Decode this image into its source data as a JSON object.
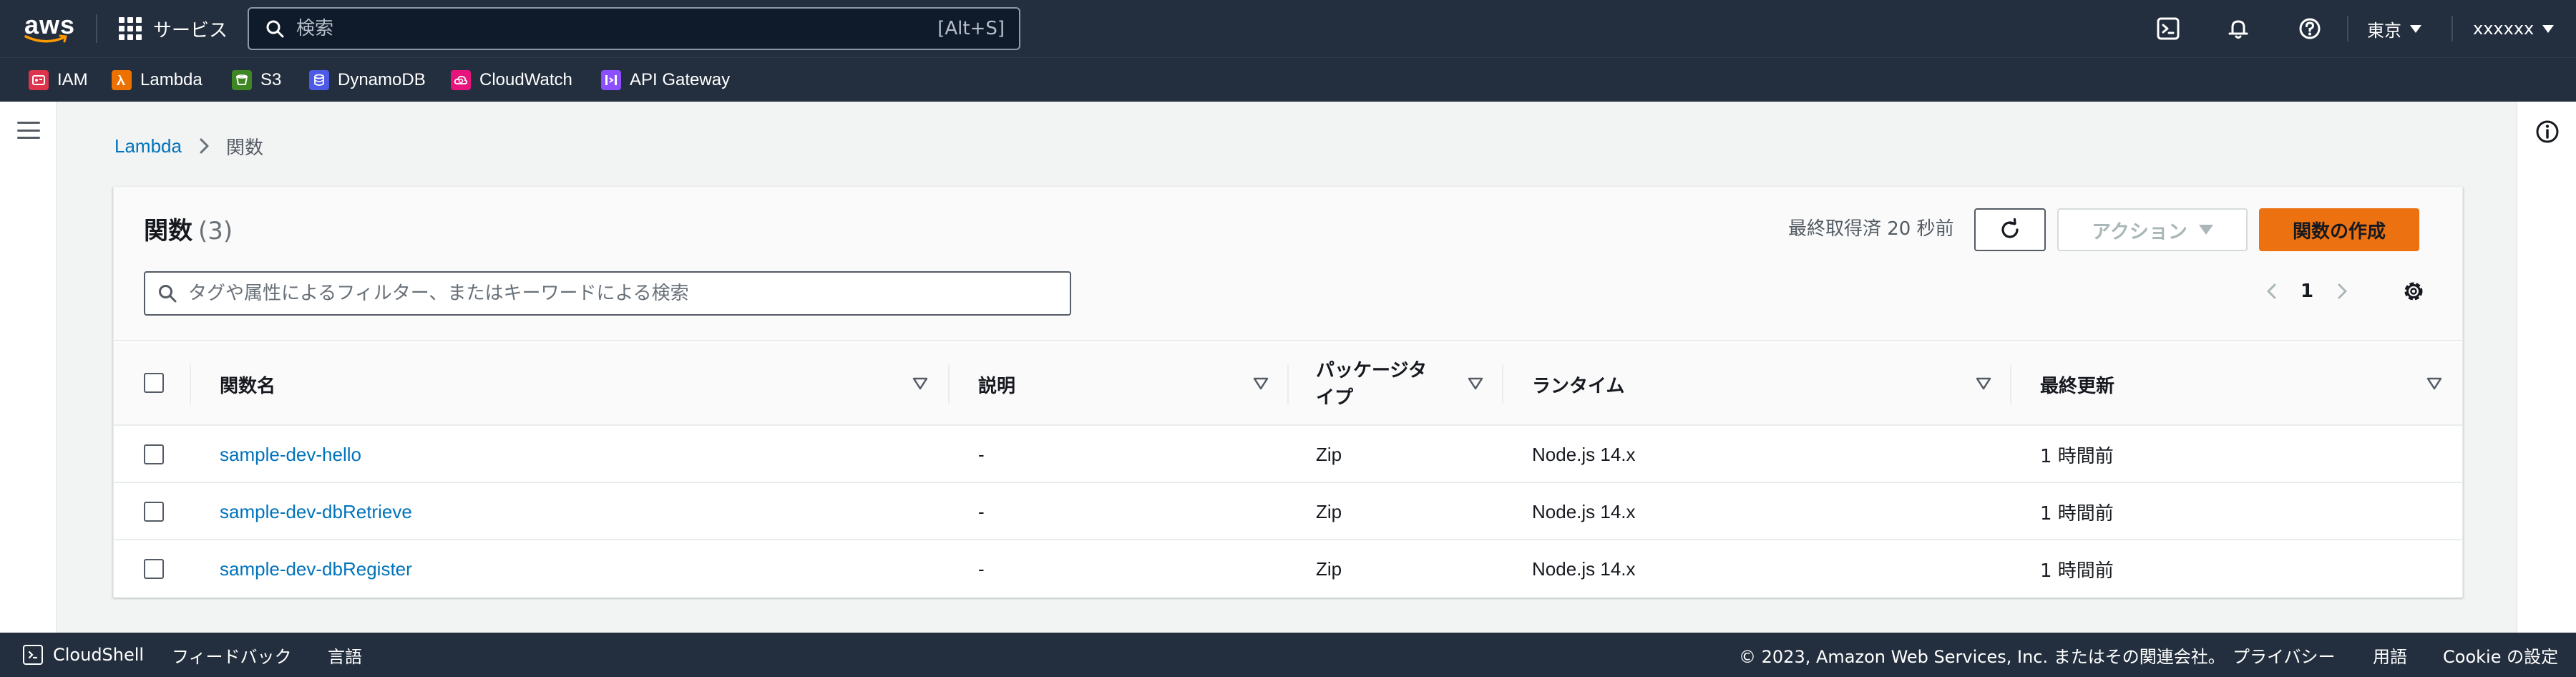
{
  "topnav": {
    "logo_text": "aws",
    "services_label": "サービス",
    "search_placeholder": "検索",
    "search_shortcut": "[Alt+S]",
    "region": "東京",
    "account": "xxxxxx"
  },
  "favorites": [
    {
      "label": "IAM",
      "icon": "iam-icon",
      "color": "#dd344c"
    },
    {
      "label": "Lambda",
      "icon": "lambda-icon",
      "color": "#ed7100"
    },
    {
      "label": "S3",
      "icon": "s3-icon",
      "color": "#3f8624"
    },
    {
      "label": "DynamoDB",
      "icon": "dynamodb-icon",
      "color": "#4d5ae5"
    },
    {
      "label": "CloudWatch",
      "icon": "cloudwatch-icon",
      "color": "#e7157b"
    },
    {
      "label": "API Gateway",
      "icon": "api-gateway-icon",
      "color": "#8c4fff"
    }
  ],
  "breadcrumb": {
    "parent": "Lambda",
    "current": "関数"
  },
  "panel": {
    "title": "関数",
    "count": "(3)",
    "last_fetched": "最終取得済 20 秒前",
    "actions_label": "アクション",
    "create_label": "関数の作成",
    "filter_placeholder": "タグや属性によるフィルター、またはキーワードによる検索",
    "page": "1"
  },
  "table": {
    "columns": [
      "関数名",
      "説明",
      "パッケージタ",
      "イプ",
      "ランタイム",
      "最終更新"
    ],
    "rows": [
      {
        "name": "sample-dev-hello",
        "description": "-",
        "package_type": "Zip",
        "runtime": "Node.js 14.x",
        "last_modified": "1 時間前"
      },
      {
        "name": "sample-dev-dbRetrieve",
        "description": "-",
        "package_type": "Zip",
        "runtime": "Node.js 14.x",
        "last_modified": "1 時間前"
      },
      {
        "name": "sample-dev-dbRegister",
        "description": "-",
        "package_type": "Zip",
        "runtime": "Node.js 14.x",
        "last_modified": "1 時間前"
      }
    ]
  },
  "footer": {
    "cloudshell": "CloudShell",
    "feedback": "フィードバック",
    "language": "言語",
    "copyright": "© 2023, Amazon Web Services, Inc. またはその関連会社。",
    "privacy": "プライバシー",
    "terms": "用語",
    "cookie": "Cookie の設定"
  },
  "colors": {
    "nav_bg": "#232f3e",
    "link": "#0073bb",
    "primary_button": "#ec7211"
  }
}
